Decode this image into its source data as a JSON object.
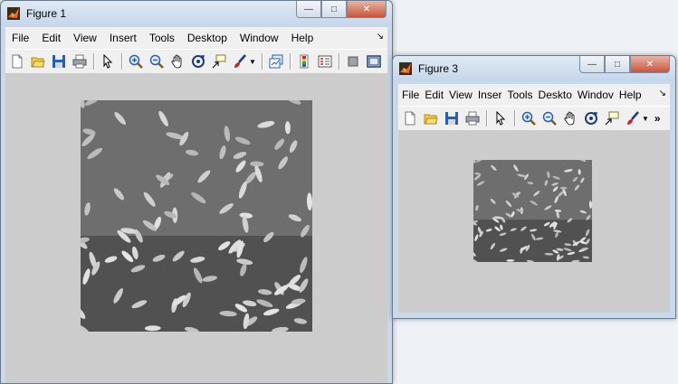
{
  "figure1": {
    "title": "Figure 1",
    "menu": [
      "File",
      "Edit",
      "View",
      "Insert",
      "Tools",
      "Desktop",
      "Window",
      "Help"
    ],
    "buttons": {
      "minimize": "—",
      "maximize": "□",
      "close": "✕"
    }
  },
  "figure3": {
    "title": "Figure 3",
    "menu": [
      "File",
      "Edit",
      "View",
      "Inser",
      "Tools",
      "Deskto",
      "Windov",
      "Help"
    ],
    "overflow": "»",
    "buttons": {
      "minimize": "—",
      "maximize": "□",
      "close": "✕"
    }
  },
  "toolbar_icons": [
    "new-figure-icon",
    "open-file-icon",
    "save-icon",
    "print-icon",
    "pointer-icon",
    "zoom-in-icon",
    "zoom-out-icon",
    "pan-hand-icon",
    "rotate-3d-icon",
    "data-cursor-icon",
    "brush-icon",
    "link-plot-icon",
    "colorbar-icon",
    "legend-icon",
    "hide-plot-tools-icon",
    "show-plot-tools-icon"
  ],
  "colors": {
    "accent": "#c7553a",
    "canvas": "#cccccc",
    "window_frame": "#c9d9ea"
  }
}
